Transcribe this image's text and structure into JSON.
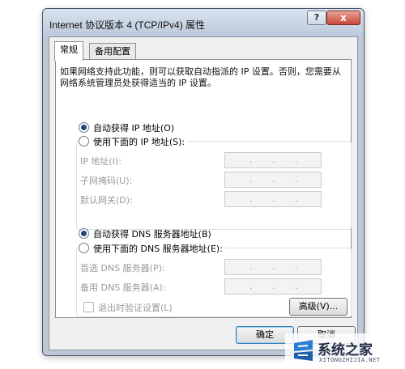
{
  "window": {
    "title": "Internet 协议版本 4 (TCP/IPv4) 属性",
    "help_label": "?",
    "close_label": "x"
  },
  "tabs": [
    {
      "label": "常规",
      "active": true
    },
    {
      "label": "备用配置",
      "active": false
    }
  ],
  "description": "如果网络支持此功能，则可以获取自动指派的 IP 设置。否则，您需要从网络系统管理员处获得适当的 IP 设置。",
  "ip_section": {
    "auto_label": "自动获得 IP 地址(O)",
    "manual_label": "使用下面的 IP 地址(S):",
    "selected": "auto",
    "fields": [
      {
        "label": "IP 地址(I):",
        "value": ". . ."
      },
      {
        "label": "子网掩码(U):",
        "value": ". . ."
      },
      {
        "label": "默认网关(D):",
        "value": ". . ."
      }
    ]
  },
  "dns_section": {
    "auto_label": "自动获得 DNS 服务器地址(B)",
    "manual_label": "使用下面的 DNS 服务器地址(E):",
    "selected": "auto",
    "fields": [
      {
        "label": "首选 DNS 服务器(P):",
        "value": ". . ."
      },
      {
        "label": "备用 DNS 服务器(A):",
        "value": ". . ."
      }
    ]
  },
  "validate_label": "退出时验证设置(L)",
  "advanced_label": "高级(V)...",
  "ok_label": "确定",
  "cancel_label": "取消",
  "watermark": {
    "text": "系统之家",
    "sub": "XITONGZHIJIA.NET"
  },
  "colors": {
    "titlebar": "#c9d5e4",
    "close": "#c9483a",
    "accent": "#3c7fb1"
  }
}
